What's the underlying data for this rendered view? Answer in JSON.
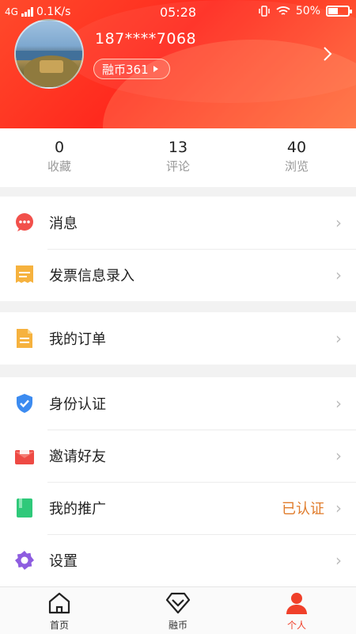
{
  "status_bar": {
    "network": "4G",
    "speed": "0.1K/s",
    "time": "05:28",
    "battery_text": "50%",
    "battery_level": 0.5
  },
  "header": {
    "phone": "187****7068",
    "coin_label": "融币361"
  },
  "stats": [
    {
      "value": "0",
      "label": "收藏"
    },
    {
      "value": "13",
      "label": "评论"
    },
    {
      "value": "40",
      "label": "浏览"
    }
  ],
  "menu": {
    "messages": "消息",
    "invoice": "发票信息录入",
    "orders": "我的订单",
    "identity": "身份认证",
    "invite": "邀请好友",
    "promotion": "我的推广",
    "promotion_status": "已认证",
    "settings": "设置"
  },
  "bottom_nav": [
    {
      "label": "首页",
      "icon": "home-icon"
    },
    {
      "label": "融币",
      "icon": "coin-icon"
    },
    {
      "label": "个人",
      "icon": "person-icon"
    }
  ],
  "colors": {
    "brand": "#ff3a24",
    "accent_orange": "#e07b2a",
    "active_tab": "#f0402a"
  }
}
